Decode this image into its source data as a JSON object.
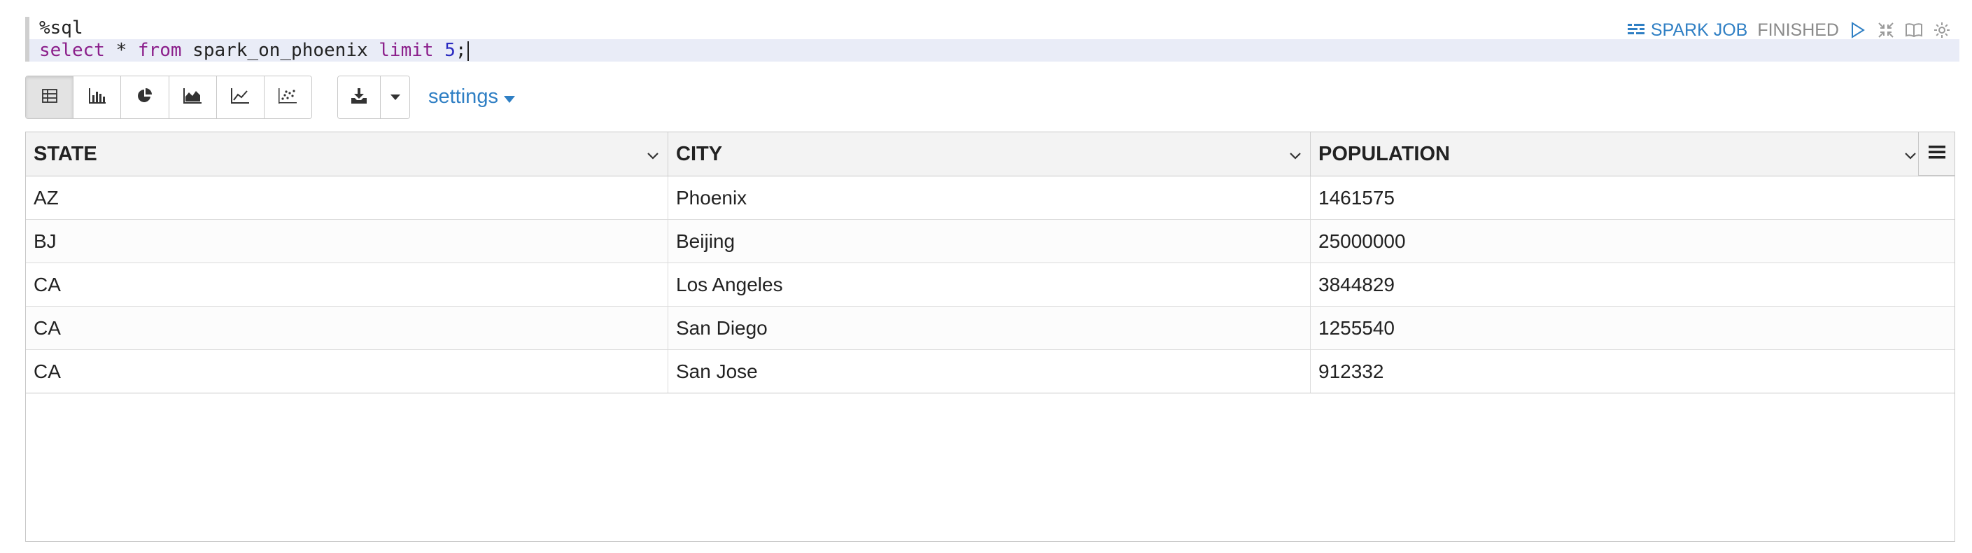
{
  "editor": {
    "line1": "%sql",
    "line2": {
      "kw_select": "select",
      "star": " * ",
      "kw_from": "from",
      "table": " spark_on_phoenix ",
      "kw_limit": "limit",
      "space": " ",
      "num": "5",
      "semi": ";"
    }
  },
  "status": {
    "spark_job_label": "SPARK JOB",
    "state_label": "FINISHED"
  },
  "toolbar": {
    "viz_buttons": [
      "table-icon",
      "bar-chart-icon",
      "pie-chart-icon",
      "area-chart-icon",
      "line-chart-icon",
      "scatter-chart-icon"
    ],
    "active_viz": "table-icon",
    "settings_label": "settings"
  },
  "table": {
    "columns": [
      "STATE",
      "CITY",
      "POPULATION"
    ],
    "rows": [
      [
        "AZ",
        "Phoenix",
        "1461575"
      ],
      [
        "BJ",
        "Beijing",
        "25000000"
      ],
      [
        "CA",
        "Los Angeles",
        "3844829"
      ],
      [
        "CA",
        "San Diego",
        "1255540"
      ],
      [
        "CA",
        "San Jose",
        "912332"
      ]
    ]
  },
  "colors": {
    "accent": "#2f7fc4",
    "keyword": "#8b1f8b",
    "number": "#2a2ac0",
    "active_line": "#e9ecf7"
  }
}
